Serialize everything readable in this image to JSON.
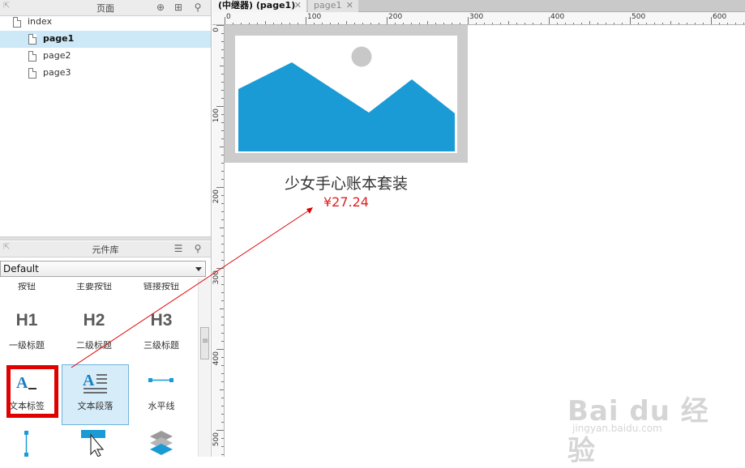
{
  "pages_panel": {
    "title": "页面",
    "tree": [
      {
        "label": "index",
        "selected": false
      },
      {
        "label": "page1",
        "selected": true
      },
      {
        "label": "page2",
        "selected": false
      },
      {
        "label": "page3",
        "selected": false
      }
    ]
  },
  "library_panel": {
    "title": "元件库",
    "selected_library": "Default",
    "partial_row_labels": [
      "按钮",
      "主要按钮",
      "链接按钮"
    ],
    "widgets": [
      {
        "glyph": "H1",
        "label": "一级标题"
      },
      {
        "glyph": "H2",
        "label": "二级标题"
      },
      {
        "glyph": "H3",
        "label": "三级标题"
      },
      {
        "label": "文本标签"
      },
      {
        "label": "文本段落"
      },
      {
        "label": "水平线"
      }
    ]
  },
  "tabs": [
    {
      "label": "(中继器) (page1)",
      "active": true
    },
    {
      "label": "page1",
      "active": false
    }
  ],
  "ruler": {
    "top_ticks": [
      "0",
      "100",
      "200",
      "300",
      "400",
      "500",
      "600"
    ],
    "left_ticks": [
      "0",
      "100",
      "200",
      "300",
      "400",
      "500"
    ]
  },
  "canvas": {
    "product_title": "少女手心账本套装",
    "product_price": "¥27.24",
    "image_colors": {
      "frame": "#cccccc",
      "mountain": "#1a9bd6",
      "sun": "#c8c8c8"
    },
    "annotation_color": "#e00000"
  },
  "watermark": {
    "main": "Bai du 经验",
    "sub": "jingyan.baidu.com"
  }
}
